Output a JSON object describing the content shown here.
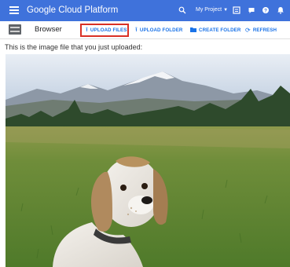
{
  "appbar": {
    "brand": "Google Cloud Platform",
    "project_label": "My Project",
    "icons": [
      "menu-icon",
      "search-icon",
      "dropdown-caret-icon",
      "console-icon",
      "help-icon",
      "notifications-icon",
      "account-icon"
    ]
  },
  "toolbar": {
    "title": "Browser",
    "upload_files": "UPLOAD FILES",
    "upload_folder": "UPLOAD FOLDER",
    "create_folder": "CREATE FOLDER",
    "refresh": "REFRESH",
    "highlight_color": "#d93025"
  },
  "main": {
    "caption": "This is the image file that you just uploaded:",
    "image_subject": "dog-in-meadow-photo"
  },
  "colors": {
    "appbar": "#3f72db",
    "accent": "#1a73e8"
  }
}
